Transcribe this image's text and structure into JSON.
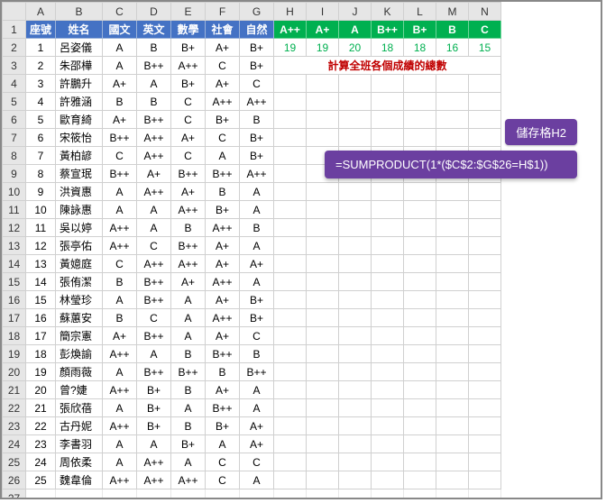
{
  "columns": [
    "A",
    "B",
    "C",
    "D",
    "E",
    "F",
    "G",
    "H",
    "I",
    "J",
    "K",
    "L",
    "M",
    "N"
  ],
  "blueHeaders": [
    "座號",
    "姓名",
    "國文",
    "英文",
    "數學",
    "社會",
    "自然"
  ],
  "greenHeaders": [
    "A++",
    "A+",
    "A",
    "B++",
    "B+",
    "B",
    "C"
  ],
  "greenValues": [
    19,
    19,
    20,
    18,
    18,
    16,
    15
  ],
  "redMessage": "計算全班各個成績的總數",
  "callout": {
    "tag": "儲存格H2",
    "formula": "=SUMPRODUCT(1*($C$2:$G$26=H$1))"
  },
  "rows": [
    {
      "n": 1,
      "name": "呂姿儀",
      "g": [
        "A",
        "B",
        "B+",
        "A+",
        "B+"
      ]
    },
    {
      "n": 2,
      "name": "朱邵樺",
      "g": [
        "A",
        "B++",
        "A++",
        "C",
        "B+"
      ]
    },
    {
      "n": 3,
      "name": "許鵬升",
      "g": [
        "A+",
        "A",
        "B+",
        "A+",
        "C"
      ]
    },
    {
      "n": 4,
      "name": "許雅涵",
      "g": [
        "B",
        "B",
        "C",
        "A++",
        "A++"
      ]
    },
    {
      "n": 5,
      "name": "歐育綺",
      "g": [
        "A+",
        "B++",
        "C",
        "B+",
        "B"
      ]
    },
    {
      "n": 6,
      "name": "宋筱怡",
      "g": [
        "B++",
        "A++",
        "A+",
        "C",
        "B+"
      ]
    },
    {
      "n": 7,
      "name": "黃柏諺",
      "g": [
        "C",
        "A++",
        "C",
        "A",
        "B+"
      ]
    },
    {
      "n": 8,
      "name": "蔡宣珉",
      "g": [
        "B++",
        "A+",
        "B++",
        "B++",
        "A++"
      ]
    },
    {
      "n": 9,
      "name": "洪資惠",
      "g": [
        "A",
        "A++",
        "A+",
        "B",
        "A"
      ]
    },
    {
      "n": 10,
      "name": "陳詠惠",
      "g": [
        "A",
        "A",
        "A++",
        "B+",
        "A"
      ]
    },
    {
      "n": 11,
      "name": "吳以婷",
      "g": [
        "A++",
        "A",
        "B",
        "A++",
        "B"
      ]
    },
    {
      "n": 12,
      "name": "張亭佑",
      "g": [
        "A++",
        "C",
        "B++",
        "A+",
        "A"
      ]
    },
    {
      "n": 13,
      "name": "黃嬑庭",
      "g": [
        "C",
        "A++",
        "A++",
        "A+",
        "A+"
      ]
    },
    {
      "n": 14,
      "name": "張侑潔",
      "g": [
        "B",
        "B++",
        "A+",
        "A++",
        "A"
      ]
    },
    {
      "n": 15,
      "name": "林瑩珍",
      "g": [
        "A",
        "B++",
        "A",
        "A+",
        "B+"
      ]
    },
    {
      "n": 16,
      "name": "蘇蕙安",
      "g": [
        "B",
        "C",
        "A",
        "A++",
        "B+"
      ]
    },
    {
      "n": 17,
      "name": "簡宗憲",
      "g": [
        "A+",
        "B++",
        "A",
        "A+",
        "C"
      ]
    },
    {
      "n": 18,
      "name": "彭煥諭",
      "g": [
        "A++",
        "A",
        "B",
        "B++",
        "B"
      ]
    },
    {
      "n": 19,
      "name": "顏雨薇",
      "g": [
        "A",
        "B++",
        "B++",
        "B",
        "B++"
      ]
    },
    {
      "n": 20,
      "name": "曾?婕",
      "g": [
        "A++",
        "B+",
        "B",
        "A+",
        "A"
      ]
    },
    {
      "n": 21,
      "name": "張欣蓓",
      "g": [
        "A",
        "B+",
        "A",
        "B++",
        "A"
      ]
    },
    {
      "n": 22,
      "name": "古丹妮",
      "g": [
        "A++",
        "B+",
        "B",
        "B+",
        "A+"
      ]
    },
    {
      "n": 23,
      "name": "李書羽",
      "g": [
        "A",
        "A",
        "B+",
        "A",
        "A+"
      ]
    },
    {
      "n": 24,
      "name": "周依柔",
      "g": [
        "A",
        "A++",
        "A",
        "C",
        "C"
      ]
    },
    {
      "n": 25,
      "name": "魏韋倫",
      "g": [
        "A++",
        "A++",
        "A++",
        "C",
        "A"
      ]
    }
  ]
}
